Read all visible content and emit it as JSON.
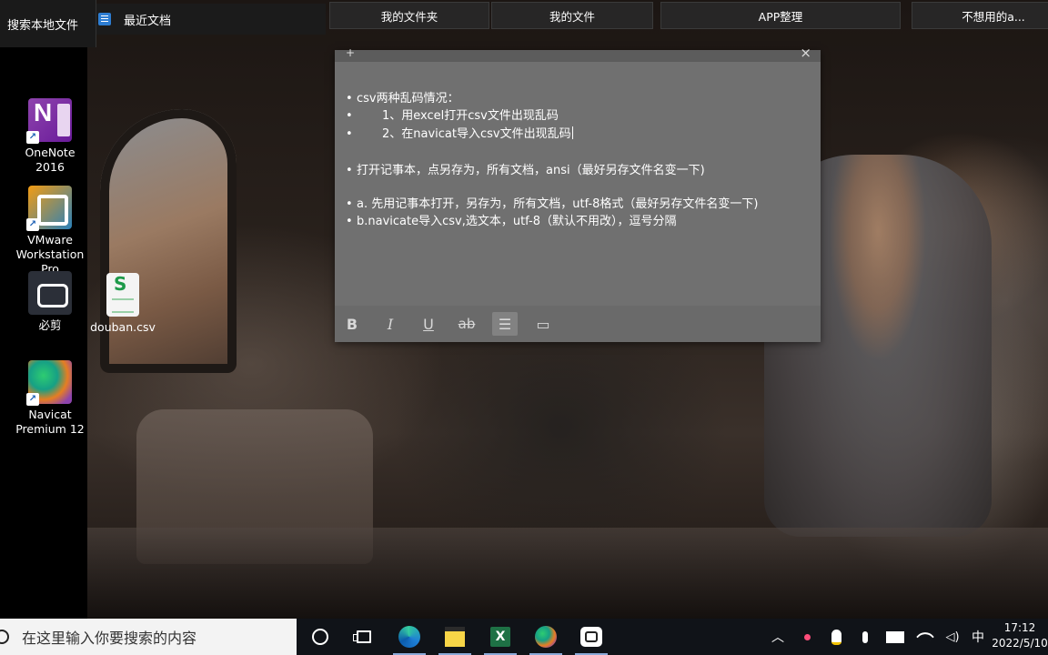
{
  "top_bar": {
    "search_local": "搜索本地文件",
    "recent_docs": "最近文档",
    "favorites": [
      "我的文件夹",
      "我的文件",
      "APP整理",
      "不想用的a..."
    ]
  },
  "desktop_icons": [
    {
      "label": "OneNote 2016",
      "icon": "onenote-icon"
    },
    {
      "label": "VMware Workstation Pro",
      "icon": "vmware-icon"
    },
    {
      "label": "必剪",
      "icon": "bijian-icon"
    },
    {
      "label": "douban.csv",
      "icon": "csv-file-icon"
    },
    {
      "label": "Navicat Premium 12",
      "icon": "navicat-icon"
    }
  ],
  "sticky_note": {
    "add_glyph": "+",
    "close_glyph": "×",
    "lines": [
      {
        "bullet": "•",
        "text": "csv两种乱码情况："
      },
      {
        "bullet": "•",
        "text": "1、用excel打开csv文件出现乱码"
      },
      {
        "bullet": "•",
        "text": "2、在navicat导入csv文件出现乱码"
      },
      {
        "bullet": "•",
        "text": "打开记事本，点另存为，所有文档，ansi（最好另存文件名变一下)"
      },
      {
        "bullet": "•",
        "text": "a. 先用记事本打开，另存为，所有文档，utf-8格式（最好另存文件名变一下)"
      },
      {
        "bullet": "•",
        "text": "b.navicate导入csv,选文本，utf-8（默认不用改），逗号分隔"
      }
    ],
    "toolbar": {
      "bold": "B",
      "italic": "I",
      "underline": "U",
      "strikethrough": "ab",
      "list": "☰",
      "image": "▭"
    }
  },
  "taskbar": {
    "search_placeholder": "在这里输入你要搜索的内容",
    "tray": {
      "chevron": "︿",
      "ime": "中",
      "time": "17:12",
      "date": "2022/5/10"
    }
  }
}
